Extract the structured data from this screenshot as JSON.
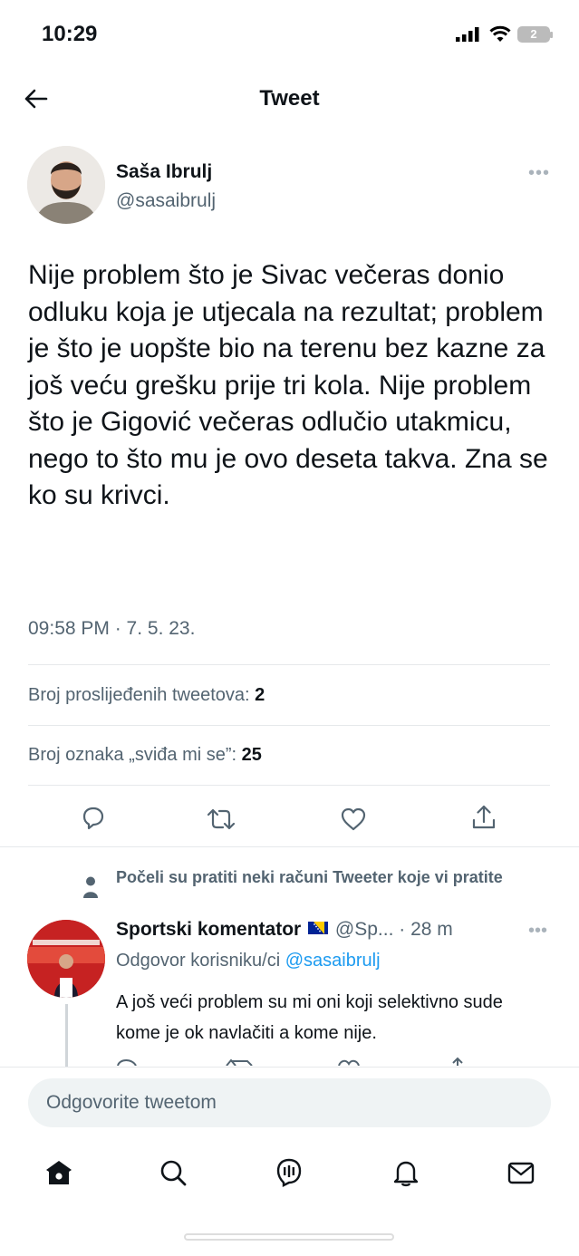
{
  "status_bar": {
    "time": "10:29",
    "battery": "2"
  },
  "header": {
    "title": "Tweet"
  },
  "tweet": {
    "author_name": "Saša Ibrulj",
    "author_handle": "@sasaibrulj",
    "text": "Nije problem što je Sivac večeras donio odluku koja je utjecala na rezultat; problem je što je uopšte bio na terenu bez kazne za još veću grešku prije tri kola. Nije problem što je Gigović večeras odlučio utakmicu, nego to što mu je ovo deseta takva. Zna se ko su krivci.",
    "timestamp": "09:58 PM · 7. 5. 23.",
    "retweets_label": "Broj proslijeđenih tweetova: ",
    "retweets_count": "2",
    "likes_label": "Broj oznaka „sviđa mi se”: ",
    "likes_count": "25"
  },
  "reply": {
    "context": "Počeli su pratiti neki računi Tweeter koje vi pratite",
    "author_name": "Sportski komentator",
    "author_handle": "@Sp...",
    "time": "· 28 m",
    "replying_to_label": "Odgovor korisniku/ci ",
    "replying_to_handle": "@sasaibrulj",
    "text": "A još veći problem su mi oni koji selektivno sude kome je ok navlačiti a kome nije."
  },
  "composer": {
    "placeholder": "Odgovorite tweetom"
  },
  "icons": {
    "back": "arrow-left-icon",
    "more": "more-horizontal-icon",
    "reply": "comment-icon",
    "retweet": "retweet-icon",
    "like": "heart-icon",
    "share": "share-icon",
    "follow_context": "person-icon",
    "flag": "bosnia-flag-icon",
    "tabs": [
      "home-icon",
      "search-icon",
      "spaces-icon",
      "notifications-icon",
      "messages-icon"
    ]
  },
  "colors": {
    "accent": "#1d9bf0",
    "text": "#0f1419",
    "secondary": "#536471"
  }
}
